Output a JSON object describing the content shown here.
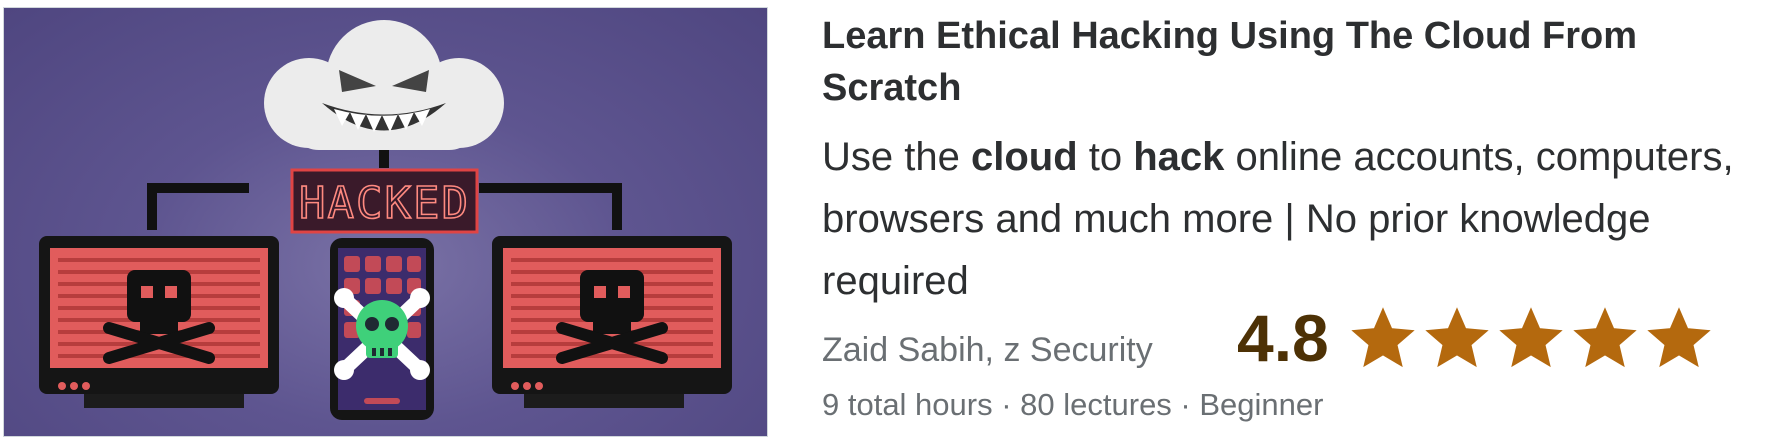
{
  "course": {
    "title": "Learn Ethical Hacking Using The Cloud From Scratch",
    "headline": {
      "t1": "Use the ",
      "b1": "cloud",
      "t2": " to ",
      "b2": "hack",
      "t3": " online accounts, computers, browsers and much more | No prior knowledge required"
    },
    "instructors": "Zaid Sabih, z Security",
    "rating": "4.8",
    "rating_value": 4.8,
    "stars_max": 5,
    "meta": {
      "hours": "9 total hours",
      "sep1": " · ",
      "lectures": "80 lectures",
      "sep2": " · ",
      "level": "Beginner"
    },
    "thumbnail": {
      "sign_text": "HACKED"
    }
  },
  "colors": {
    "rating_text": "#4d3105",
    "star": "#b4690e",
    "muted_text": "#6a6f73",
    "title_text": "#2d2f31"
  }
}
